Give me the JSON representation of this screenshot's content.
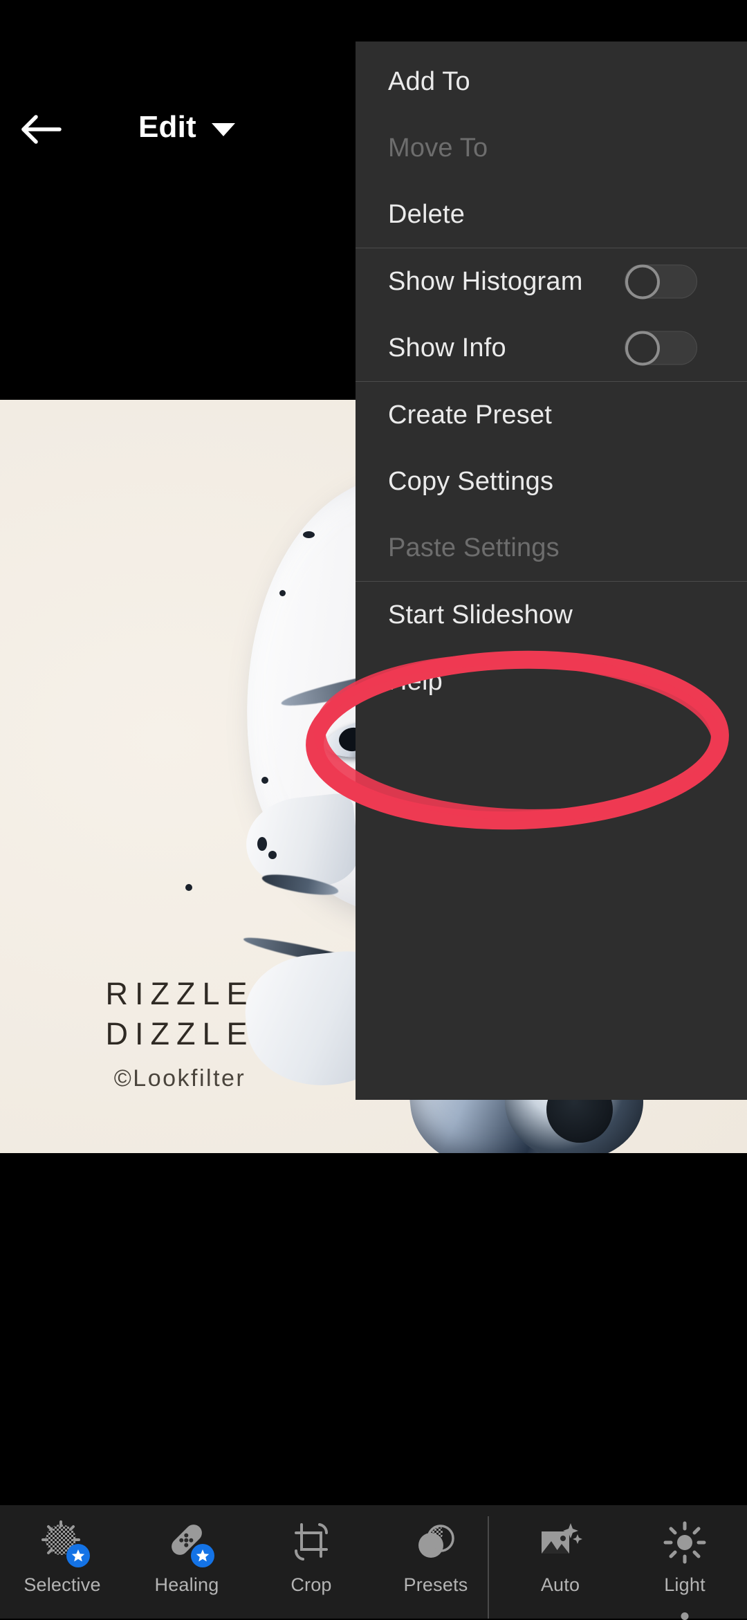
{
  "app": {
    "header": {
      "back_icon": "back-arrow-icon",
      "title": "Edit",
      "caret_icon": "chevron-down-icon"
    }
  },
  "photo": {
    "watermark_line1": "RIZZLE",
    "watermark_line2": "DIZZLE",
    "watermark_credit": "©Lookfilter",
    "background_color": "#f2ece3",
    "subject": "robot-head-photo"
  },
  "menu": {
    "background_color": "#2e2e2e",
    "groups": [
      {
        "items": [
          {
            "label": "Add To",
            "enabled": true,
            "type": "item"
          },
          {
            "label": "Move To",
            "enabled": false,
            "type": "item"
          },
          {
            "label": "Delete",
            "enabled": true,
            "type": "item"
          }
        ]
      },
      {
        "items": [
          {
            "label": "Show Histogram",
            "enabled": true,
            "type": "toggle",
            "value": "off"
          },
          {
            "label": "Show Info",
            "enabled": true,
            "type": "toggle",
            "value": "off"
          }
        ]
      },
      {
        "items": [
          {
            "label": "Create Preset",
            "enabled": true,
            "type": "item"
          },
          {
            "label": "Copy Settings",
            "enabled": true,
            "type": "item"
          },
          {
            "label": "Paste Settings",
            "enabled": false,
            "type": "item"
          }
        ]
      },
      {
        "items": [
          {
            "label": "Start Slideshow",
            "enabled": true,
            "type": "item"
          },
          {
            "label": "Help",
            "enabled": true,
            "type": "item"
          }
        ]
      }
    ]
  },
  "annotation": {
    "shape": "ellipse",
    "color": "#ee3a52",
    "targets_label": "Copy Settings"
  },
  "toolbar": {
    "accent_color": "#1473e6",
    "items": [
      {
        "label": "Selective",
        "icon": "selective-icon",
        "premium": true,
        "selected": false
      },
      {
        "label": "Healing",
        "icon": "healing-icon",
        "premium": true,
        "selected": false
      },
      {
        "label": "Crop",
        "icon": "crop-icon",
        "premium": false,
        "selected": false
      },
      {
        "label": "Presets",
        "icon": "presets-icon",
        "premium": false,
        "selected": false
      },
      {
        "label": "Auto",
        "icon": "auto-icon",
        "premium": false,
        "selected": false
      },
      {
        "label": "Light",
        "icon": "light-icon",
        "premium": false,
        "selected": true
      }
    ]
  }
}
